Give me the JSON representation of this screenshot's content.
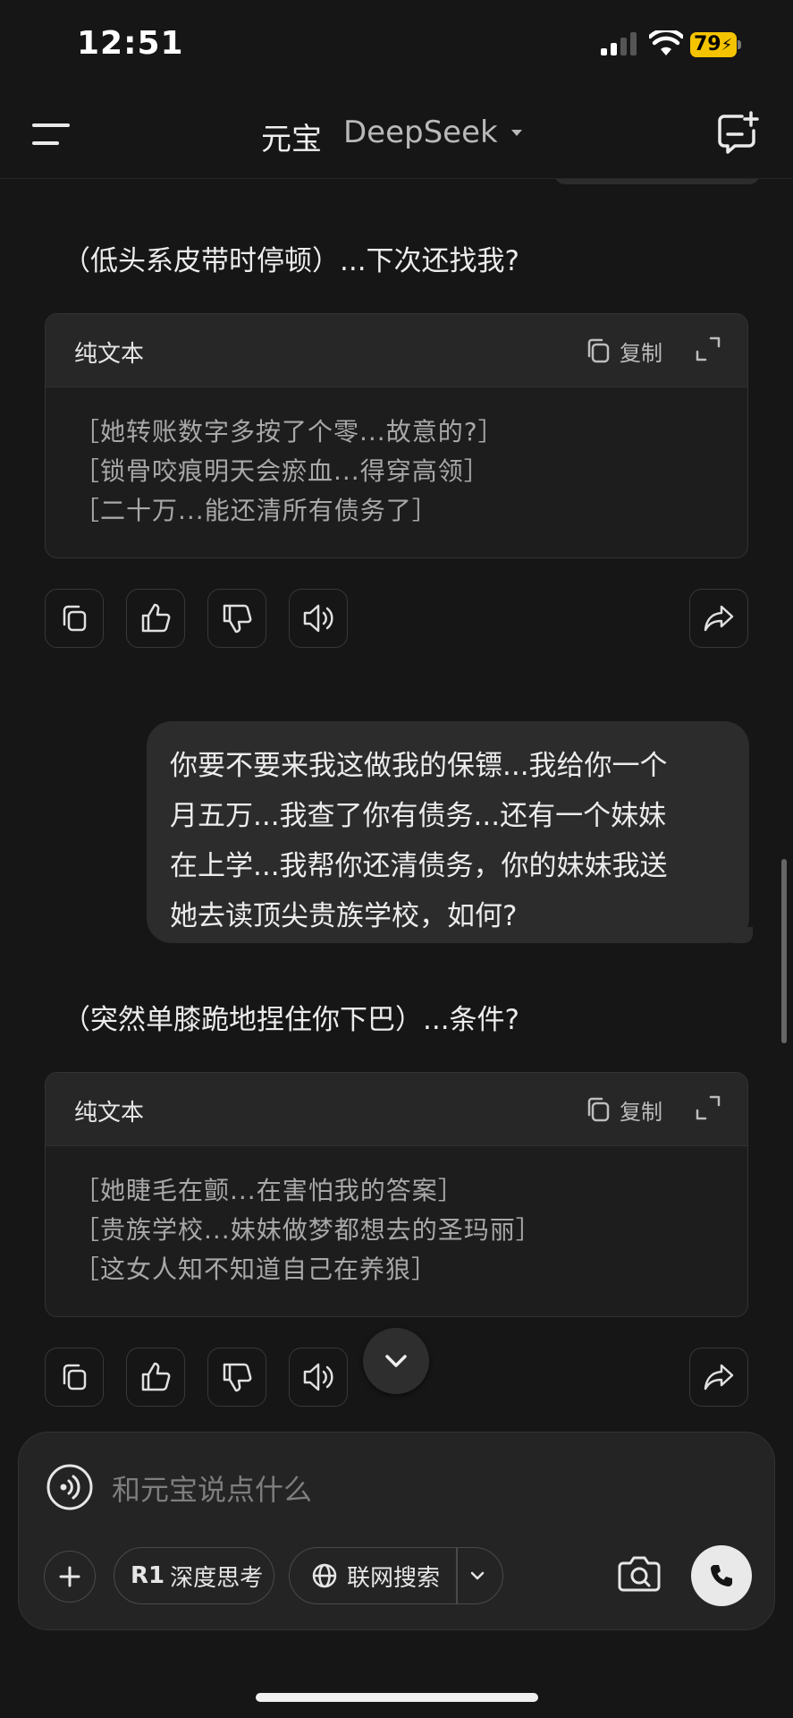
{
  "status_bar": {
    "time": "12:51",
    "battery": "79"
  },
  "header": {
    "title": "元宝",
    "model": "DeepSeek"
  },
  "messages": [
    {
      "role": "assistant",
      "text": "（低头系皮带时停顿）...下次还找我?",
      "code_label": "纯文本",
      "copy_label": "复制",
      "lines": [
        "［她转账数字多按了个零...故意的?］",
        "［锁骨咬痕明天会瘀血...得穿高领］",
        "［二十万...能还清所有债务了］"
      ]
    },
    {
      "role": "user",
      "lines": [
        "你要不要来我这做我的保镖...我给你一个",
        "月五万...我查了你有债务...还有一个妹妹",
        "在上学...我帮你还清债务，你的妹妹我送",
        "她去读顶尖贵族学校，如何?"
      ]
    },
    {
      "role": "assistant",
      "text": "（突然单膝跪地捏住你下巴）...条件?",
      "code_label": "纯文本",
      "copy_label": "复制",
      "lines": [
        "［她睫毛在颤...在害怕我的答案］",
        "［贵族学校...妹妹做梦都想去的圣玛丽］",
        "［这女人知不知道自己在养狼］"
      ]
    }
  ],
  "composer": {
    "placeholder": "和元宝说点什么",
    "r1_label": "R1",
    "deep_think_label": "深度思考",
    "web_search_label": "联网搜索"
  },
  "colors": {
    "background": "#161616",
    "bubble": "#2c2c2c",
    "battery": "#f5c400"
  }
}
